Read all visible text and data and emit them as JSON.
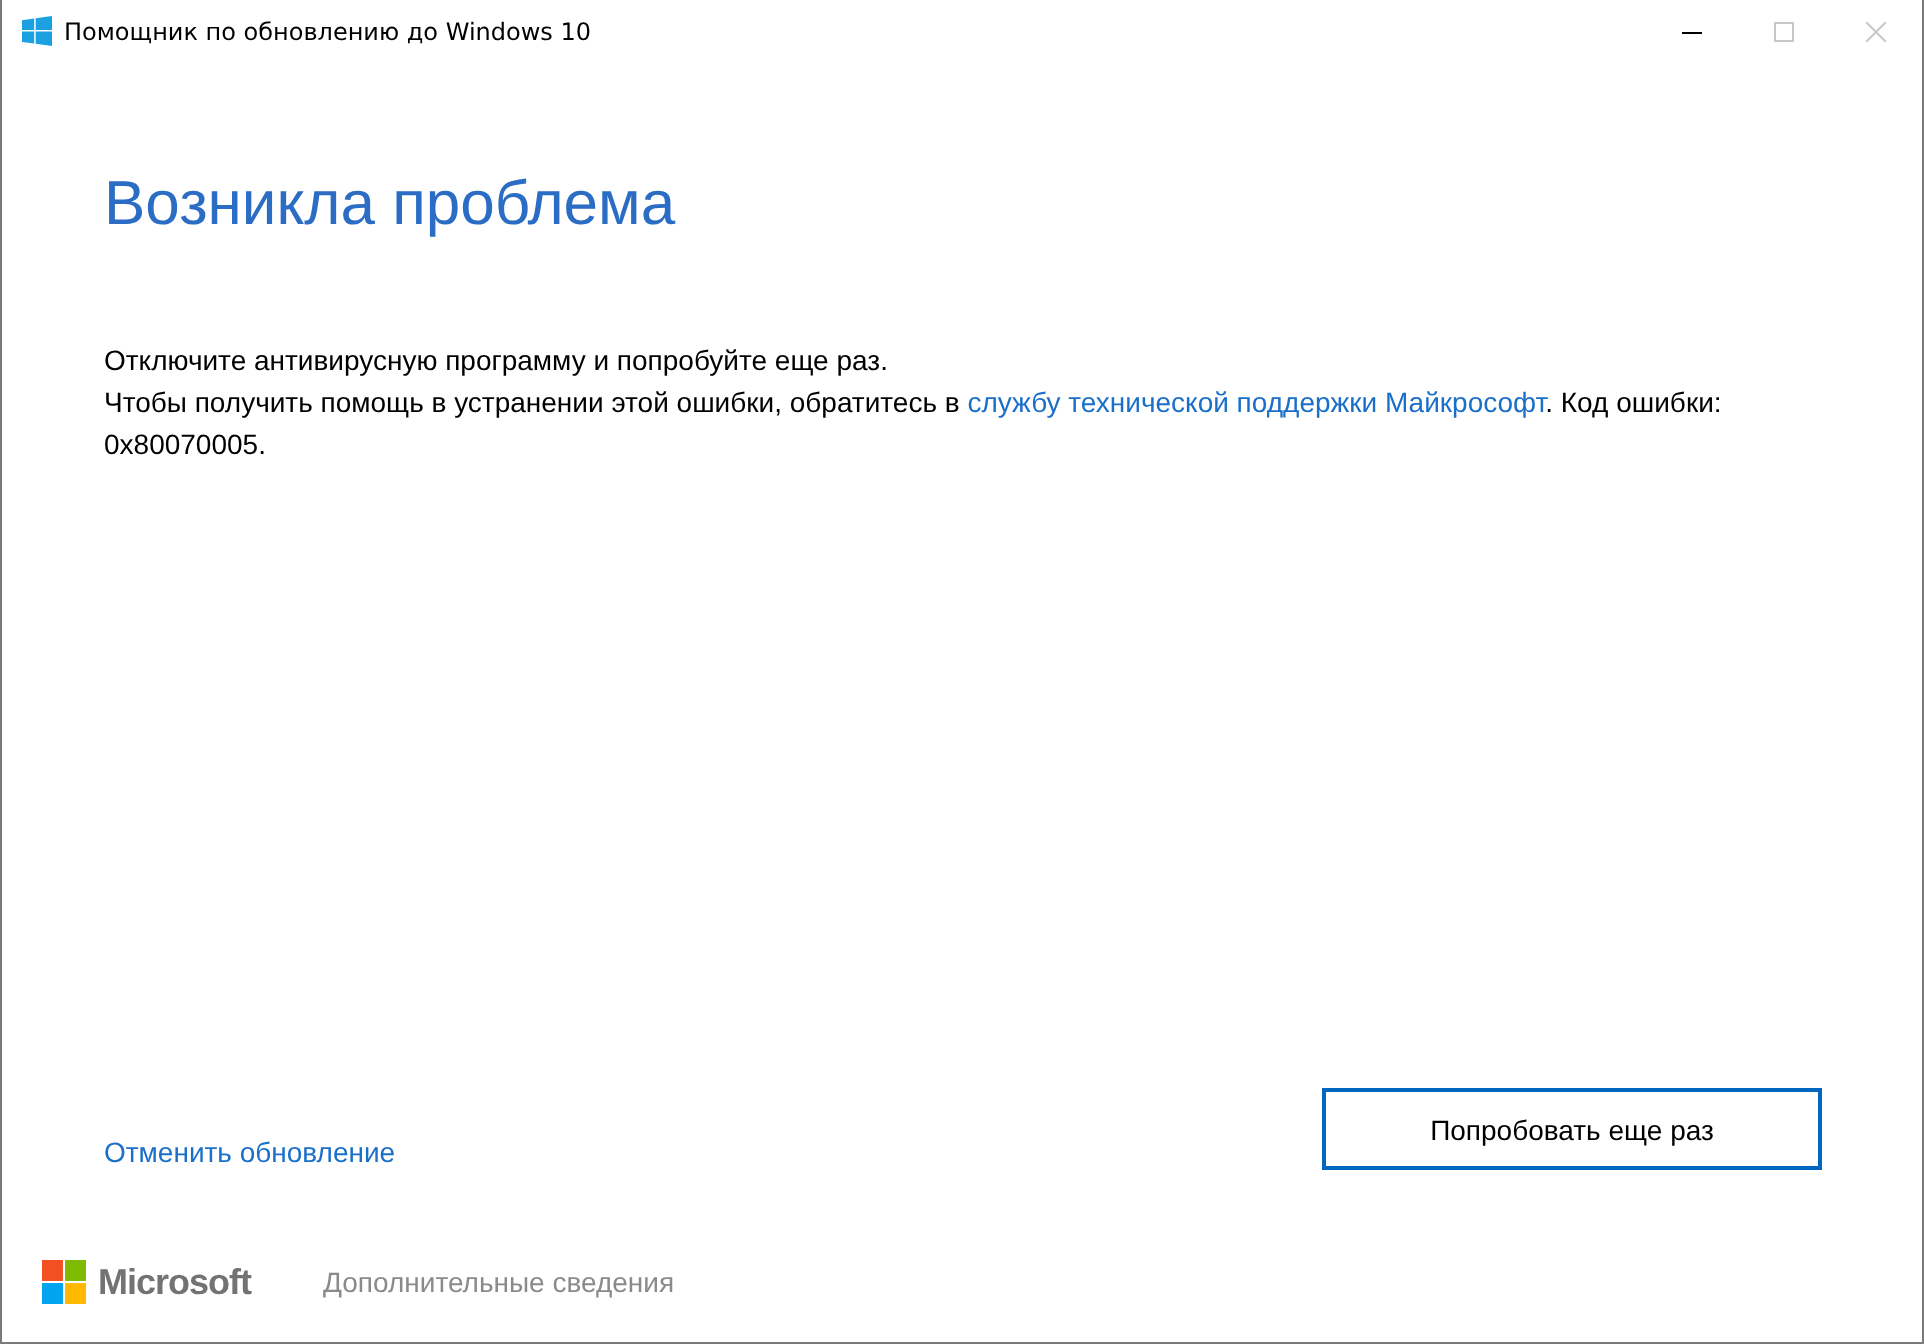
{
  "window": {
    "title": "Помощник по обновлению до Windows 10",
    "controls": [
      {
        "kind": "minimize",
        "disabled": false
      },
      {
        "kind": "maximize",
        "disabled": true
      },
      {
        "kind": "close",
        "disabled": true
      }
    ]
  },
  "heading": "Возникла проблема",
  "message": "Отключите антивирусную программу и попробуйте еще раз.",
  "help": {
    "before": "Чтобы получить помощь в устранении этой ошибки, обратитесь в ",
    "link": "службу технической поддержки Майкрософт",
    "after": ". Код ошибки: 0x80070005."
  },
  "cancel_link": "Отменить обновление",
  "retry_button": "Попробовать еще раз",
  "footer": {
    "logo_text": "Microsoft",
    "more_info": "Дополнительные сведения"
  }
}
